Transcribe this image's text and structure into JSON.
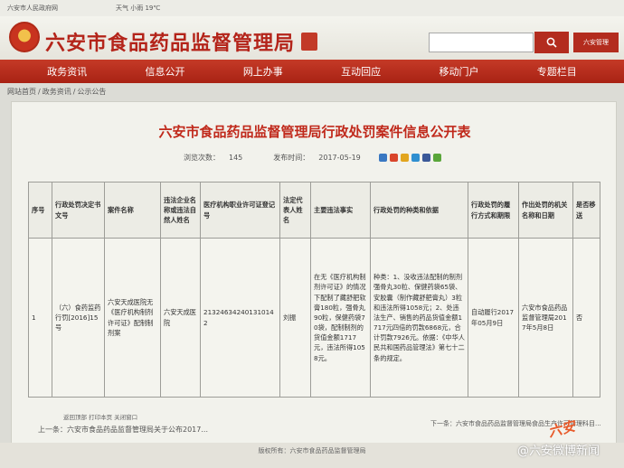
{
  "topbar": {
    "site_link": "六安市人民政府网",
    "weather": "天气 小雨 19℃",
    "links": [
      "",
      "",
      "",
      ""
    ]
  },
  "header": {
    "site_title": "六安市食品药品监督管理局",
    "search_placeholder": "",
    "admin_label": "六安管理"
  },
  "nav": {
    "items": [
      "政务资讯",
      "信息公开",
      "网上办事",
      "互动回应",
      "移动门户",
      "专题栏目"
    ]
  },
  "breadcrumb": [
    "网站首页",
    "政务资讯",
    "公示公告"
  ],
  "document": {
    "title": "六安市食品药品监督管理局行政处罚案件信息公开表",
    "views_label": "浏览次数：",
    "views": "145",
    "published_label": "发布时间：",
    "published": "2017-05-19"
  },
  "table": {
    "headers": [
      "序号",
      "行政处罚决定书文号",
      "案件名称",
      "违法企业名称或违法自然人姓名",
      "医疗机构职业许可证登记号",
      "法定代表人姓名",
      "主要违法事实",
      "行政处罚的种类和依据",
      "行政处罚的履行方式和期限",
      "作出处罚的机关名称和日期",
      "是否移送"
    ],
    "row": [
      "1",
      "（六）食药监药行罚[2016]15号",
      "六安天成医院无《医疗机构制剂许可证》配制制剂案",
      "六安天成医院",
      "213246342401310142",
      "刘振",
      "在无《医疗机构制剂许可证》的情况下配制了藏舒舥软膏180粒，强骨丸90粒，保健药袋70袋，配制制剂的货值金额1717元，违法所得1058元。",
      "种类：1、没收违法配制的制剂强骨丸30粒、保健药袋65袋、安胶囊（制作藏舒舥膏丸）3粒和违法所得1058元；2、处违法生产、销售的药品货值金额1717元四倍的罚款6868元，合计罚款7926元。依据：《中华人民共和国药品管理法》第七十二条的规定。",
      "自动履行2017年05月9日",
      "六安市食品药品监督管理局2017年5月8日",
      "否"
    ]
  },
  "page_tools": "返回顶部 打印本页 关闭窗口",
  "prev_label": "上一条：六安市食品药品监督管理局关于公布2017...",
  "next_label": "下一条：六安市食品药品监督管理局食品生产许可管理科目...",
  "footer": {
    "text": "版权所有：六安市食品药品监督管理局"
  },
  "watermark": {
    "text": "@六安微博新闻"
  },
  "colors": {
    "brand_red": "#b32c1e",
    "title_red": "#c0291b"
  }
}
